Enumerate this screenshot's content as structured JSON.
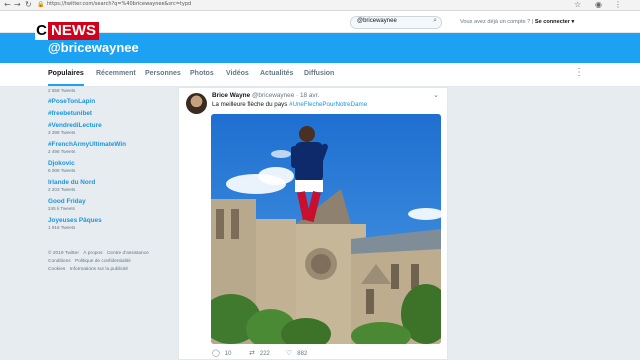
{
  "browser": {
    "url": "https://twitter.com/search?q=%40bricewaynee&src=typd",
    "icons": [
      "star-icon",
      "account-icon",
      "menu-icon"
    ]
  },
  "overlay": {
    "logo_c": "C",
    "logo_news": "NEWS"
  },
  "topbar": {
    "search_value": "@bricewaynee",
    "account_prompt": "Vous avez déjà un compte ?",
    "login_label": "Se connecter ▾"
  },
  "header": {
    "title": "@bricewaynee",
    "band_color": "#1da1f2"
  },
  "nav": {
    "tabs": [
      {
        "label": "Populaires"
      },
      {
        "label": "Récemment"
      },
      {
        "label": "Personnes"
      },
      {
        "label": "Photos"
      },
      {
        "label": "Vidéos"
      },
      {
        "label": "Actualités"
      },
      {
        "label": "Diffusion"
      }
    ],
    "active_index": 0
  },
  "trends": [
    {
      "tag": "",
      "count": "2 558 Tweets"
    },
    {
      "tag": "#PoseTonLapin",
      "count": ""
    },
    {
      "tag": "#freebetunibet",
      "count": ""
    },
    {
      "tag": "#VendrediLecture",
      "count": "3 398 Tweets"
    },
    {
      "tag": "#FrenchArmyUltimateWin",
      "count": "2 496 Tweets"
    },
    {
      "tag": "Djokovic",
      "count": "6 006 Tweets"
    },
    {
      "tag": "Irlande du Nord",
      "count": "2 203 Tweets"
    },
    {
      "tag": "Good Friday",
      "count": "245 k Tweets"
    },
    {
      "tag": "Joyeuses Pâques",
      "count": "1 916 Tweets"
    }
  ],
  "footer": {
    "line1": [
      "© 2019 Twitter",
      "À propos",
      "Centre d'assistance"
    ],
    "line2": [
      "Conditions",
      "Politique de confidentialité"
    ],
    "line3": [
      "Cookies",
      "Informations sur la publicité"
    ]
  },
  "tweet": {
    "author": "Brice Wayne",
    "handle": "@bricewaynee",
    "time": "· 18 avr.",
    "text": "La meilleure flèche du pays",
    "hashtag": "#UneFlechePourNotreDame",
    "replies": "10",
    "retweets": "222",
    "likes": "882"
  }
}
